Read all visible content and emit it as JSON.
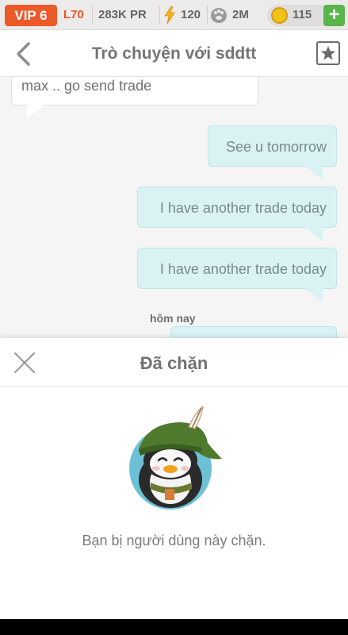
{
  "status_bar": {
    "vip": "VIP 6",
    "level": "L70",
    "pr": "283K PR",
    "energy": "120",
    "paws": "2M",
    "coins": "115",
    "plus": "+"
  },
  "chat_header": {
    "title": "Trò chuyện với sddtt"
  },
  "messages": [
    {
      "from": "them",
      "text": "max .. go send trade"
    },
    {
      "from": "me",
      "text": "See u tomorrow"
    },
    {
      "from": "me",
      "text": "I have another trade today"
    },
    {
      "from": "me",
      "text": "I have another trade today"
    }
  ],
  "day_label": "hôm nay",
  "blocked_panel": {
    "title": "Đã chặn",
    "message": "Bạn bị người dùng này chặn."
  },
  "colors": {
    "vip": "#ec5a2a",
    "level": "#e7572a",
    "plus": "#5ab44a",
    "coin": "#f2c21b",
    "my_bubble": "#d9f3f4",
    "avatar_bg": "#6cc1d6"
  },
  "icons": {
    "energy": "lightning-icon",
    "paws": "paw-icon",
    "coins": "coin-icon",
    "back": "chevron-left-icon",
    "favorite": "star-icon",
    "close": "close-icon"
  }
}
